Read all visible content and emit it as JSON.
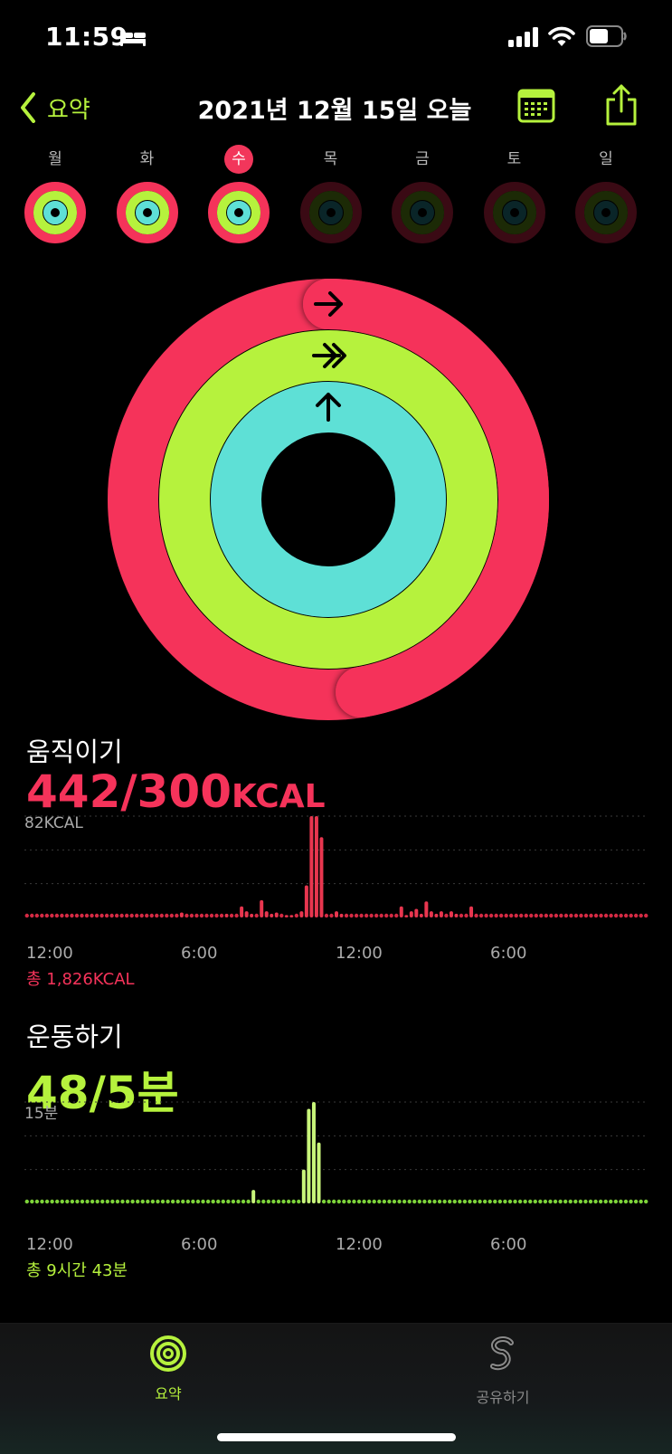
{
  "status": {
    "time": "11:59"
  },
  "nav": {
    "back_label": "요약",
    "title": "2021년 12월 15일 오늘"
  },
  "week": {
    "days": [
      {
        "label": "월",
        "today": false,
        "active": true
      },
      {
        "label": "화",
        "today": false,
        "active": true
      },
      {
        "label": "수",
        "today": true,
        "active": true
      },
      {
        "label": "목",
        "today": false,
        "active": false
      },
      {
        "label": "금",
        "today": false,
        "active": false
      },
      {
        "label": "토",
        "today": false,
        "active": false
      },
      {
        "label": "일",
        "today": false,
        "active": false
      }
    ]
  },
  "rings": {
    "move_progress": 1.4733,
    "exercise_progress": 9.6,
    "stand_progress": 1.0
  },
  "move": {
    "title": "움직이기",
    "value": "442/300",
    "unit": "KCAL",
    "chart_max": "82KCAL",
    "time_labels": [
      "12:00",
      "6:00",
      "12:00",
      "6:00"
    ],
    "total": "총 1,826KCAL"
  },
  "exercise": {
    "title": "운동하기",
    "value": "48/5분",
    "chart_max": "15분",
    "time_labels": [
      "12:00",
      "6:00",
      "12:00",
      "6:00"
    ],
    "total": "총 9시간 43분"
  },
  "tabs": [
    {
      "label": "요약",
      "active": true
    },
    {
      "label": "공유하기",
      "active": false
    }
  ],
  "colors": {
    "move": "#f5335a",
    "exercise": "#b6f23d",
    "stand": "#5ee0d6",
    "accent": "#b6f23d"
  },
  "chart_data": [
    {
      "type": "bar",
      "title": "움직이기",
      "ylabel": "82KCAL",
      "ylim": [
        0,
        82
      ],
      "xlabel": "",
      "x_ticks": [
        "12:00",
        "6:00",
        "12:00",
        "6:00"
      ],
      "values": [
        0,
        0,
        0,
        0,
        0,
        0,
        0,
        0,
        0,
        0,
        0,
        0,
        0,
        0,
        0,
        0,
        0,
        0,
        0,
        0,
        0,
        0,
        0,
        0,
        0,
        0,
        0,
        0,
        0,
        0,
        0,
        4,
        0,
        0,
        0,
        0,
        0,
        0,
        0,
        0,
        3,
        0,
        0,
        9,
        5,
        3,
        0,
        14,
        5,
        3,
        4,
        0,
        2,
        2,
        0,
        5,
        26,
        82,
        82,
        65,
        0,
        0,
        5,
        3,
        0,
        0,
        0,
        0,
        0,
        0,
        0,
        0,
        0,
        0,
        0,
        9,
        2,
        5,
        7,
        3,
        13,
        5,
        3,
        5,
        0,
        5,
        3,
        0,
        0,
        9,
        0,
        0,
        0,
        0,
        0,
        0,
        0,
        0,
        0,
        0,
        0,
        0,
        0,
        0,
        0,
        0,
        0,
        0,
        0,
        0,
        0,
        0,
        0,
        0,
        0,
        0,
        0,
        0,
        0,
        0,
        0,
        0,
        0,
        0,
        0
      ]
    },
    {
      "type": "bar",
      "title": "운동하기",
      "ylabel": "15분",
      "ylim": [
        0,
        15
      ],
      "xlabel": "",
      "x_ticks": [
        "12:00",
        "6:00",
        "12:00",
        "6:00"
      ],
      "values": [
        0,
        0,
        0,
        0,
        0,
        0,
        0,
        0,
        0,
        0,
        0,
        0,
        0,
        0,
        0,
        0,
        0,
        0,
        0,
        0,
        0,
        0,
        0,
        0,
        0,
        0,
        0,
        0,
        0,
        0,
        0,
        0,
        0,
        0,
        0,
        0,
        0,
        0,
        0,
        0,
        0,
        0,
        0,
        0,
        0,
        2,
        0,
        0,
        0,
        0,
        0,
        0,
        0,
        0,
        0,
        5,
        14,
        15,
        9,
        0,
        0,
        0,
        0,
        0.5,
        0,
        0,
        0,
        0,
        0,
        0,
        0,
        0,
        0,
        0,
        0,
        0,
        0,
        0,
        0,
        0,
        0,
        0,
        0,
        0,
        0,
        0,
        0,
        0,
        0,
        0,
        0,
        0,
        0,
        0,
        0,
        0,
        0,
        0,
        0,
        0,
        0,
        0,
        0,
        0,
        0,
        0,
        0,
        0,
        0,
        0,
        0,
        0,
        0,
        0,
        0,
        0,
        0,
        0,
        0,
        0,
        0,
        0,
        0,
        0
      ]
    }
  ]
}
